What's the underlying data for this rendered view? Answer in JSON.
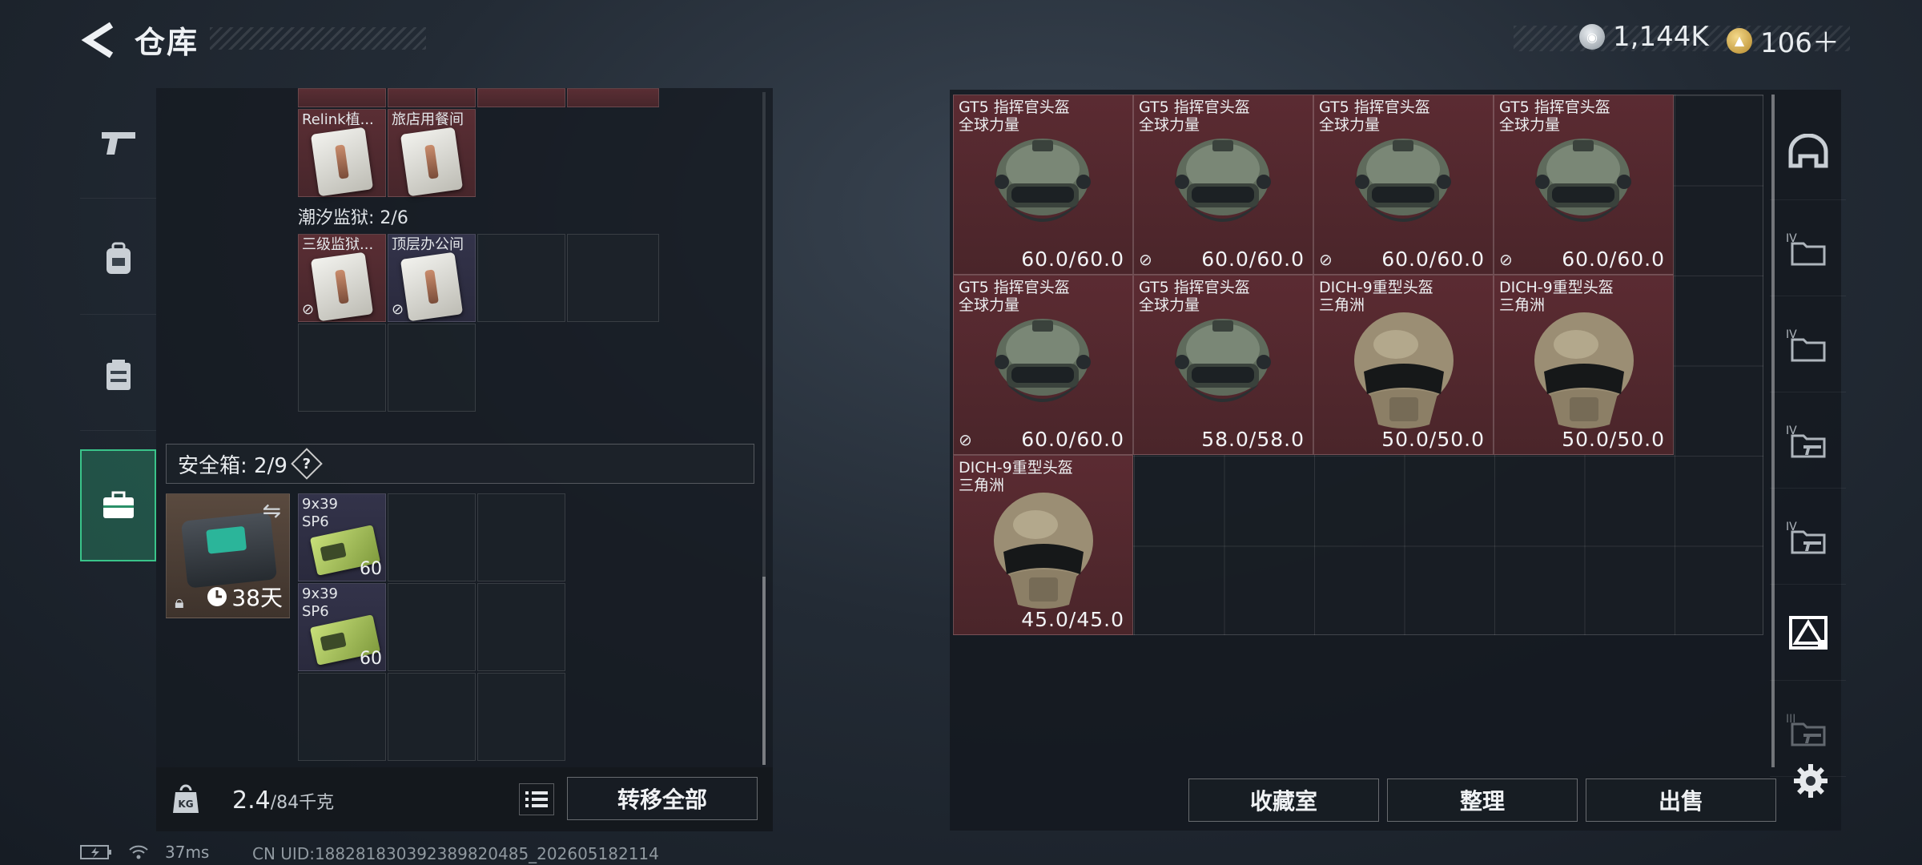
{
  "header": {
    "title": "仓库",
    "currency_silver": "1,144K",
    "currency_gold": "106＋"
  },
  "left_nav": [
    {
      "icon": "pistol-icon"
    },
    {
      "icon": "backpack-icon"
    },
    {
      "icon": "chest-rig-icon"
    },
    {
      "icon": "safe-box-icon",
      "active": true
    }
  ],
  "keys": {
    "top_row_labels": [
      "Relink植...",
      "旅店用餐间"
    ],
    "section_label": "潮汐监狱: 2/6",
    "prison_items": [
      {
        "label": "三级监狱..."
      },
      {
        "label": "顶层办公间"
      }
    ]
  },
  "safebox": {
    "label": "安全箱: 2/9",
    "help": "?",
    "duration": "38天",
    "ammo": [
      {
        "label": "9x39\nSP6",
        "qty": "60"
      },
      {
        "label": "9x39\nSP6",
        "qty": "60"
      }
    ]
  },
  "footer_left": {
    "weight_value": "2.4",
    "weight_cap": "/84千克",
    "kg_icon": "KG",
    "list_icon": "list-icon",
    "transfer_all": "转移全部"
  },
  "stash_items": [
    {
      "name": "GT5 指挥官头盔\n全球力量",
      "durability": "60.0/60.0",
      "kind": "gt5",
      "no_sell": false
    },
    {
      "name": "GT5 指挥官头盔\n全球力量",
      "durability": "60.0/60.0",
      "kind": "gt5",
      "no_sell": true
    },
    {
      "name": "GT5 指挥官头盔\n全球力量",
      "durability": "60.0/60.0",
      "kind": "gt5",
      "no_sell": true
    },
    {
      "name": "GT5 指挥官头盔\n全球力量",
      "durability": "60.0/60.0",
      "kind": "gt5",
      "no_sell": true
    },
    {
      "name": "GT5 指挥官头盔\n全球力量",
      "durability": "60.0/60.0",
      "kind": "gt5",
      "no_sell": true
    },
    {
      "name": "GT5 指挥官头盔\n全球力量",
      "durability": "58.0/58.0",
      "kind": "gt5",
      "no_sell": false
    },
    {
      "name": "DICH-9重型头盔\n三角洲",
      "durability": "50.0/50.0",
      "kind": "dich",
      "no_sell": false
    },
    {
      "name": "DICH-9重型头盔\n三角洲",
      "durability": "50.0/50.0",
      "kind": "dich",
      "no_sell": false
    },
    {
      "name": "DICH-9重型头盔\n三角洲",
      "durability": "45.0/45.0",
      "kind": "dich",
      "no_sell": false
    }
  ],
  "right_nav": [
    {
      "label": "",
      "icon": "helmet-tab-icon"
    },
    {
      "label": "IV",
      "icon": "folder-IV-icon"
    },
    {
      "label": "IV",
      "icon": "folder-IV-icon-2"
    },
    {
      "label": "IV",
      "icon": "gun-folder-IV-icon"
    },
    {
      "label": "IV",
      "icon": "gun-folder-IV-icon-2"
    },
    {
      "label": "",
      "icon": "triangle-folder-icon",
      "active": true
    },
    {
      "label": "III",
      "icon": "gun-folder-III-icon"
    }
  ],
  "footer_right": {
    "collection": "收藏室",
    "organize": "整理",
    "sell": "出售"
  },
  "status": {
    "ping": "37ms",
    "uid": "CN UID:18828183039238982048​5_202605182114"
  }
}
